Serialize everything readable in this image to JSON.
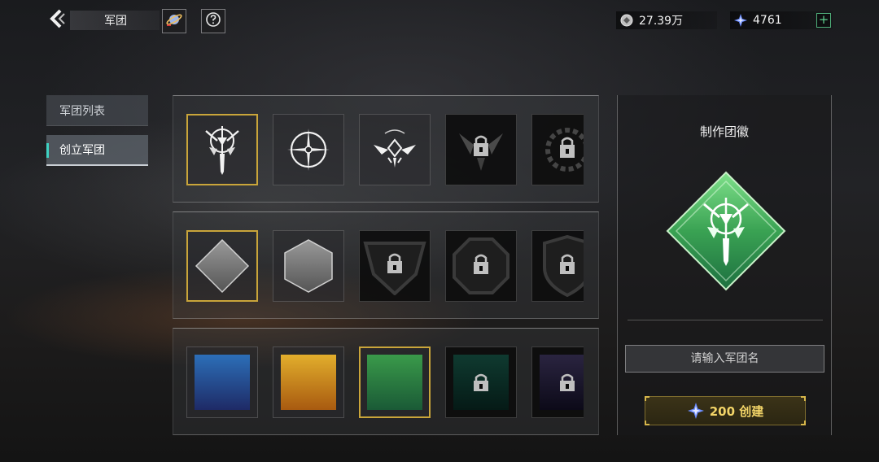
{
  "header": {
    "title": "军团",
    "back_icon": "chevron-left-icon",
    "planet_icon": "planet-icon",
    "help_icon": "question-mark-icon"
  },
  "currencies": {
    "coin": {
      "icon": "coin-icon",
      "value": "27.39万"
    },
    "crystal": {
      "icon": "crystal-icon",
      "value": "4761",
      "plus": "+"
    }
  },
  "sidebar": {
    "items": [
      {
        "label": "军团列表",
        "active": false
      },
      {
        "label": "创立军团",
        "active": true
      }
    ]
  },
  "emblem_patterns": {
    "items": [
      {
        "name": "winged-sword-emblem",
        "selected": true,
        "locked": false
      },
      {
        "name": "crosshair-emblem",
        "selected": false,
        "locked": false
      },
      {
        "name": "wings-emblem",
        "selected": false,
        "locked": false
      },
      {
        "name": "winged-lock-emblem",
        "selected": false,
        "locked": true
      },
      {
        "name": "gear-lock-emblem",
        "selected": false,
        "locked": true
      }
    ]
  },
  "emblem_shapes": {
    "items": [
      {
        "name": "diamond-shape",
        "selected": true,
        "locked": false
      },
      {
        "name": "hexagon-shape",
        "selected": false,
        "locked": false
      },
      {
        "name": "pentagon-shape",
        "selected": false,
        "locked": true
      },
      {
        "name": "octagon-shape",
        "selected": false,
        "locked": true
      },
      {
        "name": "shield-shape",
        "selected": false,
        "locked": true
      }
    ]
  },
  "emblem_colors": {
    "items": [
      {
        "name": "blue",
        "top": "#2c6fb8",
        "bottom": "#1e2a66",
        "selected": false,
        "locked": false
      },
      {
        "name": "orange",
        "top": "#e2ae2c",
        "bottom": "#a85a10",
        "selected": false,
        "locked": false
      },
      {
        "name": "green",
        "top": "#3a9a4a",
        "bottom": "#1a5a36",
        "selected": true,
        "locked": false
      },
      {
        "name": "dark-teal",
        "top": "#0f3a30",
        "bottom": "#051a16",
        "selected": false,
        "locked": true
      },
      {
        "name": "dark-purple",
        "top": "#2a2440",
        "bottom": "#0c0a18",
        "selected": false,
        "locked": true
      }
    ]
  },
  "preview": {
    "title": "制作团徽",
    "emblem_color": "#3aa253",
    "name_placeholder": "请输入军团名",
    "create_cost": "200",
    "create_label": "创建",
    "create_text": "200 创建"
  },
  "colors": {
    "selected_border": "#c9a53a",
    "accent_teal": "#3fd1c2",
    "gold_text": "#f3d568"
  }
}
